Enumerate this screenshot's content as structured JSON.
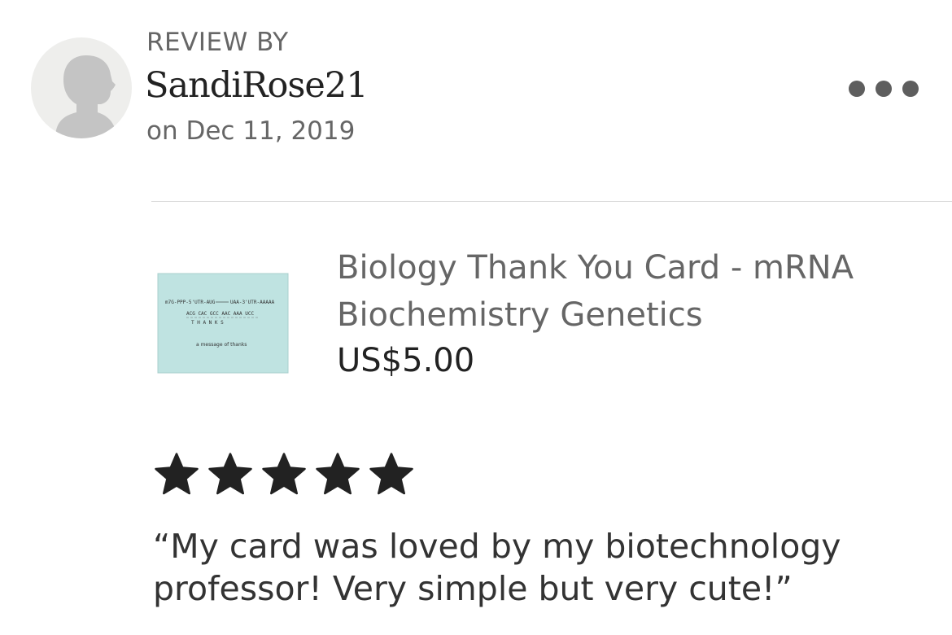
{
  "review": {
    "header_label": "REVIEW BY",
    "reviewer_name": "SandiRose21",
    "date": "on Dec 11, 2019",
    "rating": 5,
    "rating_max": 5,
    "text": "“My card was loved by my biotechnology professor! Very simple but very cute!”"
  },
  "product": {
    "title": "Biology Thank You Card - mRNA Biochemistry Genetics",
    "price": "US$5.00",
    "thumbnail": {
      "line1": "m7G-PPP-5'UTR-AUG",
      "line1_right": "UAA-3'UTR-AAAAA",
      "codons": "ACG CAC GCC AAC AAA UCC",
      "word": "T H A N K S",
      "caption": "a message of thanks"
    }
  },
  "icons": {
    "avatar": "default-user-silhouette",
    "more": "more-options-dots-icon",
    "star": "filled-star-icon"
  },
  "colors": {
    "star": "#222222",
    "card_bg": "#bfe3e1",
    "avatar_bg": "#eeeeec",
    "avatar_silhouette": "#c4c4c4",
    "secondary_text": "#666666"
  }
}
